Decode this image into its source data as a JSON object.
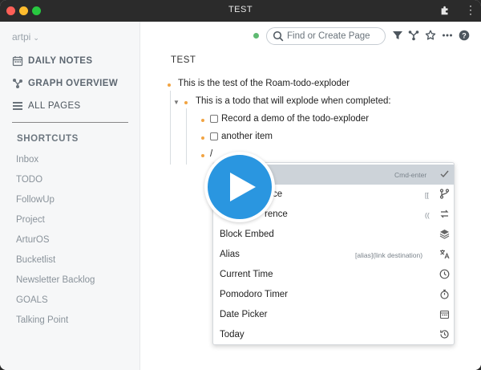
{
  "window": {
    "title": "TEST"
  },
  "sidebar": {
    "graph_name": "artpi",
    "nav": [
      {
        "label": "DAILY NOTES",
        "icon": "calendar-icon"
      },
      {
        "label": "GRAPH OVERVIEW",
        "icon": "graph-icon"
      },
      {
        "label": "ALL PAGES",
        "icon": "list-icon"
      }
    ],
    "shortcuts_header": "SHORTCUTS",
    "shortcuts": [
      "Inbox",
      "TODO",
      "FollowUp",
      "Project",
      "ArturOS",
      "Bucketlist",
      "Newsletter Backlog",
      "GOALS",
      "Talking Point"
    ]
  },
  "topbar": {
    "search_placeholder": "Find or Create Page",
    "sync_status_color": "#5fba72"
  },
  "page": {
    "title": "TEST",
    "blocks": [
      {
        "text": "This is the test of the Roam-todo-exploder"
      },
      {
        "text": "This is a todo that will explode when completed:"
      },
      {
        "text": "Record a demo of the todo-exploder"
      },
      {
        "text": "another item"
      },
      {
        "text": "/"
      }
    ]
  },
  "slash_menu": {
    "items": [
      {
        "label": "",
        "hint": "Cmd-enter",
        "icon": "check-icon",
        "selected": true
      },
      {
        "label": "ce",
        "hint": "[[",
        "icon": "branch-icon"
      },
      {
        "label": "rence",
        "hint": "((",
        "icon": "arrows-icon"
      },
      {
        "label": "Block Embed",
        "hint": "",
        "icon": "layers-icon"
      },
      {
        "label": "Alias",
        "hint": "[alias](link destination)",
        "icon": "translate-icon"
      },
      {
        "label": "Current Time",
        "hint": "",
        "icon": "clock-icon"
      },
      {
        "label": "Pomodoro Timer",
        "hint": "",
        "icon": "stopwatch-icon"
      },
      {
        "label": "Date Picker",
        "hint": "",
        "icon": "calendar-icon"
      },
      {
        "label": "Today",
        "hint": "",
        "icon": "history-icon"
      }
    ]
  },
  "overlay": {
    "icon": "play-icon",
    "color": "#2a96e0"
  }
}
